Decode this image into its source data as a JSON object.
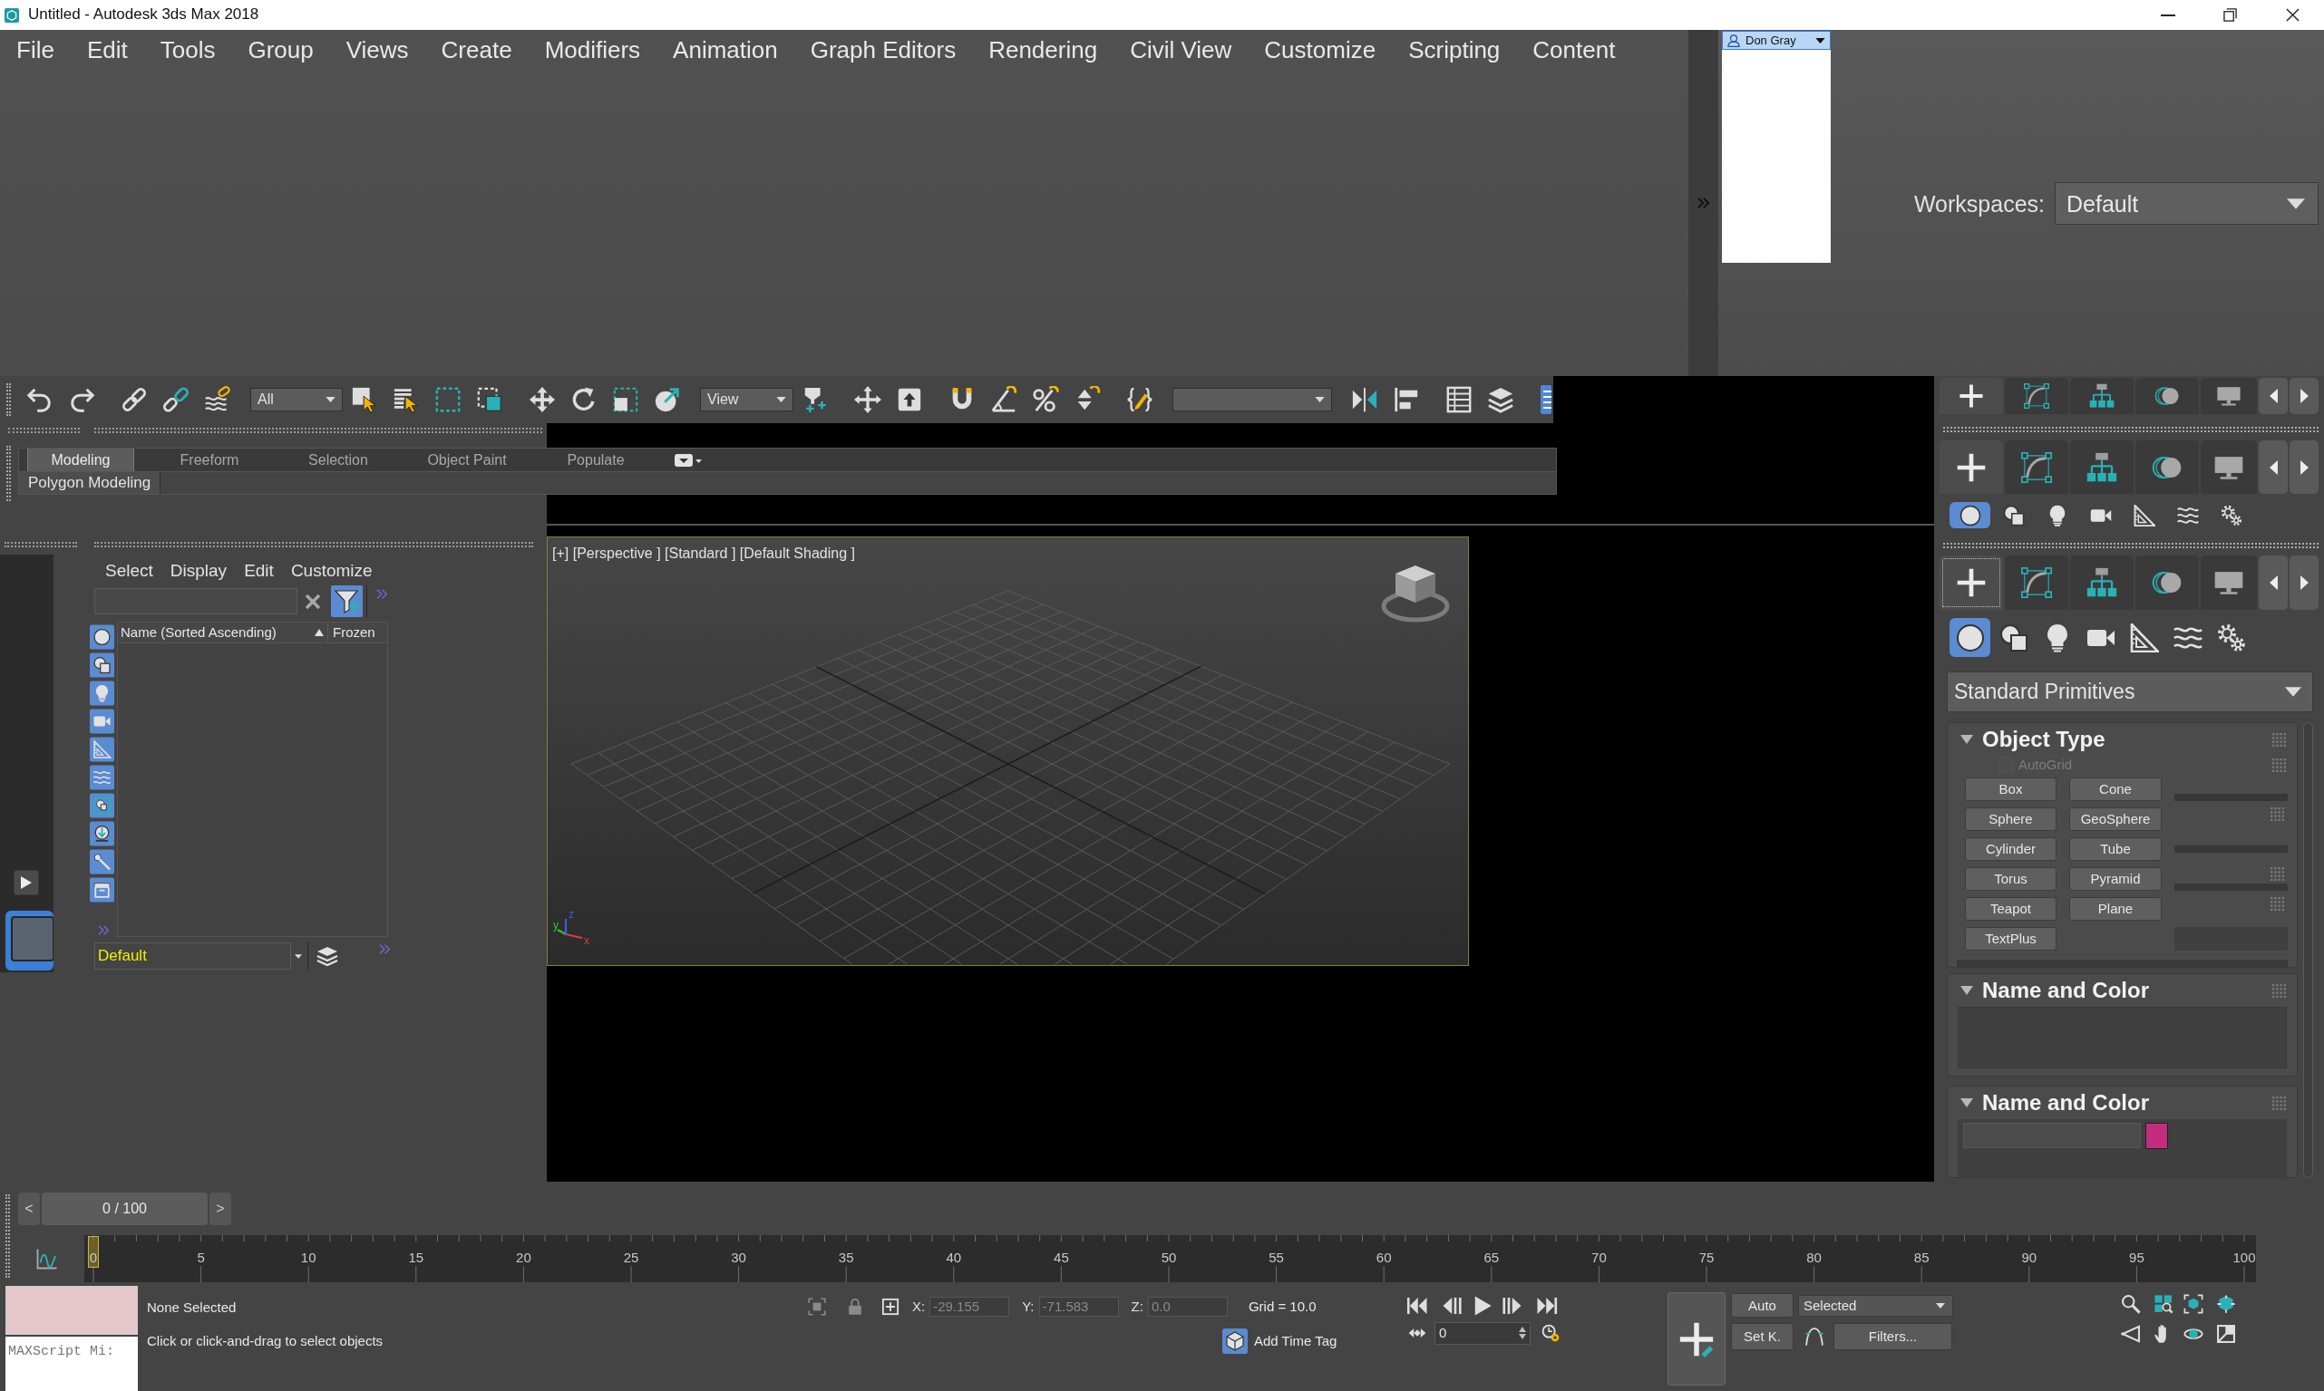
{
  "window": {
    "title": "Untitled - Autodesk 3ds Max 2018"
  },
  "menu_bar": [
    "File",
    "Edit",
    "Tools",
    "Group",
    "Views",
    "Create",
    "Modifiers",
    "Animation",
    "Graph Editors",
    "Rendering",
    "Civil View",
    "Customize",
    "Scripting",
    "Content"
  ],
  "account": {
    "user": "Don Gray"
  },
  "workspaces": {
    "label": "Workspaces:",
    "value": "Default"
  },
  "main_toolbar": {
    "selection_filter": "All",
    "reference_coordinate_system": "View"
  },
  "ribbon": {
    "tabs": [
      {
        "label": "Modeling",
        "selected": true
      },
      {
        "label": "Freeform",
        "selected": false
      },
      {
        "label": "Selection",
        "selected": false
      },
      {
        "label": "Object Paint",
        "selected": false
      },
      {
        "label": "Populate",
        "selected": false
      }
    ],
    "panel": "Polygon Modeling"
  },
  "scene_explorer": {
    "menu": [
      "Select",
      "Display",
      "Edit",
      "Customize"
    ],
    "columns": [
      "Name (Sorted Ascending)",
      "Frozen"
    ],
    "layer": "Default"
  },
  "viewport": {
    "label": "[+] [Perspective ] [Standard ] [Default Shading ]",
    "active": true,
    "axes": [
      {
        "label": "x",
        "color": "#e03a3a"
      },
      {
        "label": "y",
        "color": "#34c234"
      },
      {
        "label": "z",
        "color": "#3a5fe0"
      }
    ]
  },
  "command_panel": {
    "tabs": [
      {
        "selected": true
      },
      {
        "selected": false
      },
      {
        "selected": false
      },
      {
        "selected": false
      },
      {
        "selected": false
      }
    ],
    "categories": [
      {
        "selected": true
      },
      {
        "selected": false
      },
      {
        "selected": false
      },
      {
        "selected": false
      },
      {
        "selected": false
      },
      {
        "selected": false
      },
      {
        "selected": false
      }
    ],
    "object_category": "Standard Primitives",
    "object_type": {
      "title": "Object Type",
      "expanded": true,
      "autogrid": {
        "label": "AutoGrid",
        "checked": false,
        "disabled": true
      },
      "buttons": [
        "Box",
        "Cone",
        "Sphere",
        "GeoSphere",
        "Cylinder",
        "Tube",
        "Torus",
        "Pyramid",
        "Teapot",
        "Plane",
        "TextPlus"
      ]
    },
    "name_and_color": [
      {
        "title": "Name and Color",
        "expanded": true
      },
      {
        "title": "Name and Color",
        "expanded": true,
        "color": "#c42d7f"
      }
    ]
  },
  "time_slider": {
    "previous": "<",
    "position": "0 / 100",
    "next": ">",
    "level": 0
  },
  "track_bar": {
    "frame_labels": [
      "0",
      "5",
      "10",
      "15",
      "20",
      "25",
      "30",
      "35",
      "40",
      "45",
      "50",
      "55",
      "60",
      "65",
      "70",
      "75",
      "80",
      "85",
      "90",
      "95",
      "100"
    ]
  },
  "status_bar": {
    "listener": "MAXScript Mi:",
    "selection": "None Selected",
    "prompt": "Click or click-and-drag to select objects",
    "coordinates": [
      {
        "label": "X:",
        "value": "-29.155",
        "disabled": true
      },
      {
        "label": "Y:",
        "value": "-71.583",
        "disabled": true
      },
      {
        "label": "Z:",
        "value": "0.0",
        "disabled": true
      }
    ],
    "grid": "Grid = 10.0",
    "time_tag": "Add Time Tag"
  },
  "animation_controls": {
    "current_frame": "0",
    "auto_key": "Auto",
    "key_target": "Selected",
    "set_key": "Set K.",
    "key_filters": "Filters..."
  }
}
